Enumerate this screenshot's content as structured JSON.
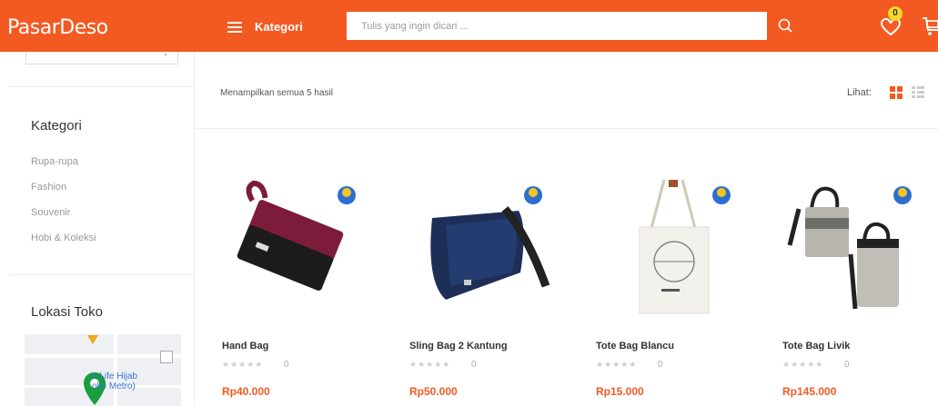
{
  "header": {
    "logo": "PasarDeso",
    "category_label": "Kategori",
    "search_placeholder": "Tulis yang ingin dicari ...",
    "wishlist_count": "0"
  },
  "sidebar": {
    "category_title": "Kategori",
    "categories": [
      "Rupa-rupa",
      "Fashion",
      "Souvenir",
      "Hobi & Koleksi"
    ],
    "location_title": "Lokasi Toko",
    "map_label_line1": "e Life Hijab",
    "map_label_line2": "oko Metro)"
  },
  "toolbar": {
    "result_text": "Menampilkan semua 5 hasil",
    "view_label": "Lihat:"
  },
  "products": [
    {
      "name": "Hand Bag",
      "rating_count": "0",
      "price": "Rp40.000"
    },
    {
      "name": "Sling Bag 2 Kantung",
      "rating_count": "0",
      "price": "Rp50.000"
    },
    {
      "name": "Tote Bag Blancu",
      "rating_count": "0",
      "price": "Rp15.000"
    },
    {
      "name": "Tote Bag Livik",
      "rating_count": "0",
      "price": "Rp145.000"
    }
  ],
  "stars_text": "★★★★★",
  "colors": {
    "brand": "#f35a22",
    "badge": "#f6d62b",
    "map_pin": "#1a9e3d"
  }
}
